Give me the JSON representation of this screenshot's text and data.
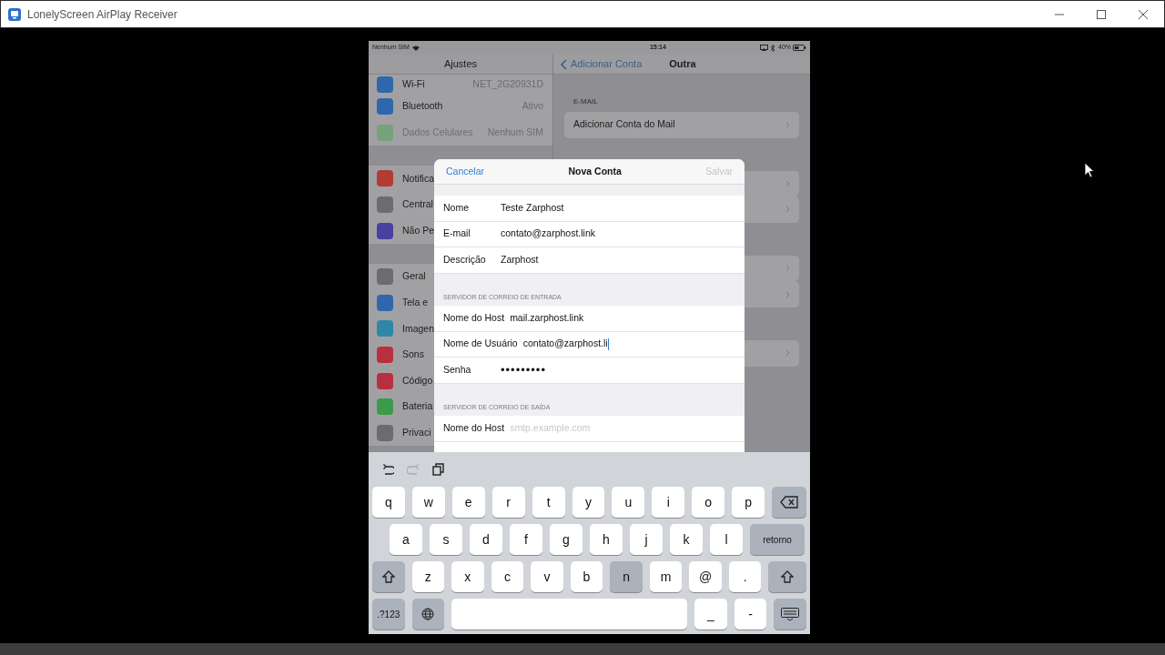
{
  "window": {
    "title": "LonelyScreen AirPlay Receiver"
  },
  "status_bar": {
    "carrier": "Nenhum SIM",
    "time": "15:14",
    "battery": "40%"
  },
  "settings": {
    "title": "Ajustes",
    "groups": [
      [
        {
          "label": "Wi-Fi",
          "value": "NET_2G20931D",
          "color": "#2f67ad",
          "disabled": false
        },
        {
          "label": "Bluetooth",
          "value": "Ativo",
          "color": "#2f67ad",
          "disabled": false
        },
        {
          "label": "Dados Celulares",
          "value": "Nenhum SIM",
          "color": "#77a27c",
          "disabled": true
        }
      ],
      [
        {
          "label": "Notifica",
          "color": "#b33b32",
          "disabled": false
        },
        {
          "label": "Central",
          "color": "#6c6c70",
          "disabled": false
        },
        {
          "label": "Não Pe",
          "color": "#4a40a0",
          "disabled": false
        }
      ],
      [
        {
          "label": "Geral",
          "color": "#6c6c70",
          "disabled": false
        },
        {
          "label": "Tela e",
          "color": "#2f67ad",
          "disabled": false
        },
        {
          "label": "Imagen",
          "color": "#2e87a8",
          "disabled": false
        },
        {
          "label": "Sons",
          "color": "#b8303f",
          "disabled": false
        },
        {
          "label": "Código",
          "color": "#b8303f",
          "disabled": false
        },
        {
          "label": "Bateria",
          "color": "#3d9a4c",
          "disabled": false
        },
        {
          "label": "Privaci",
          "color": "#6c6c70",
          "disabled": false
        }
      ]
    ]
  },
  "detail": {
    "back": "Adicionar Conta",
    "title": "Outra",
    "section": "E-MAIL",
    "row": "Adicionar Conta do Mail"
  },
  "dialog": {
    "cancel": "Cancelar",
    "title": "Nova Conta",
    "save": {
      "label": "Salvar",
      "disabled": true
    },
    "sections": [
      {
        "fields": [
          {
            "label": "Nome",
            "value": "Teste Zarphost",
            "focused": false
          },
          {
            "label": "E-mail",
            "value": "contato@zarphost.link",
            "focused": false
          },
          {
            "label": "Descrição",
            "value": "Zarphost",
            "focused": false
          }
        ]
      },
      {
        "header": "SERVIDOR DE CORREIO DE ENTRADA",
        "fields": [
          {
            "label": "Nome do Host",
            "value": "mail.zarphost.link",
            "focused": false
          },
          {
            "label": "Nome de Usuário",
            "value": "contato@zarphost.li",
            "focused": true
          },
          {
            "label": "Senha",
            "value": "•••••••••",
            "focused": false
          }
        ]
      },
      {
        "header": "SERVIDOR DE CORREIO DE SAÍDA",
        "fields": [
          {
            "label": "Nome do Host",
            "placeholder": "smtp.example.com",
            "focused": false
          }
        ]
      }
    ]
  },
  "keyboard": {
    "toolbar": [
      {
        "kind": "undo",
        "disabled": false
      },
      {
        "kind": "redo",
        "disabled": true
      },
      {
        "kind": "paste",
        "disabled": false
      }
    ],
    "rows": [
      [
        {
          "kind": "char",
          "label": "q",
          "pressed": false
        },
        {
          "kind": "char",
          "label": "w",
          "pressed": false
        },
        {
          "kind": "char",
          "label": "e",
          "pressed": false
        },
        {
          "kind": "char",
          "label": "r",
          "pressed": false
        },
        {
          "kind": "char",
          "label": "t",
          "pressed": false
        },
        {
          "kind": "char",
          "label": "y",
          "pressed": false
        },
        {
          "kind": "char",
          "label": "u",
          "pressed": false
        },
        {
          "kind": "char",
          "label": "i",
          "pressed": false
        },
        {
          "kind": "char",
          "label": "o",
          "pressed": false
        },
        {
          "kind": "char",
          "label": "p",
          "pressed": false
        },
        {
          "kind": "backspace"
        }
      ],
      [
        {
          "kind": "char",
          "label": "a",
          "pressed": false
        },
        {
          "kind": "char",
          "label": "s",
          "pressed": false
        },
        {
          "kind": "char",
          "label": "d",
          "pressed": false
        },
        {
          "kind": "char",
          "label": "f",
          "pressed": false
        },
        {
          "kind": "char",
          "label": "g",
          "pressed": false
        },
        {
          "kind": "char",
          "label": "h",
          "pressed": false
        },
        {
          "kind": "char",
          "label": "j",
          "pressed": false
        },
        {
          "kind": "char",
          "label": "k",
          "pressed": false
        },
        {
          "kind": "char",
          "label": "l",
          "pressed": false
        },
        {
          "kind": "return",
          "label": "retorno"
        }
      ],
      [
        {
          "kind": "shift"
        },
        {
          "kind": "char",
          "label": "z",
          "pressed": false
        },
        {
          "kind": "char",
          "label": "x",
          "pressed": false
        },
        {
          "kind": "char",
          "label": "c",
          "pressed": false
        },
        {
          "kind": "char",
          "label": "v",
          "pressed": false
        },
        {
          "kind": "char",
          "label": "b",
          "pressed": false
        },
        {
          "kind": "char",
          "label": "n",
          "pressed": true
        },
        {
          "kind": "char",
          "label": "m",
          "pressed": false
        },
        {
          "kind": "char",
          "label": "@",
          "pressed": false
        },
        {
          "kind": "char",
          "label": ".",
          "pressed": false
        },
        {
          "kind": "shift"
        }
      ],
      [
        {
          "kind": "mode",
          "label": ".?123"
        },
        {
          "kind": "globe"
        },
        {
          "kind": "space"
        },
        {
          "kind": "char",
          "label": "_",
          "pressed": false
        },
        {
          "kind": "char",
          "label": "-",
          "pressed": false
        },
        {
          "kind": "hide"
        }
      ]
    ]
  }
}
